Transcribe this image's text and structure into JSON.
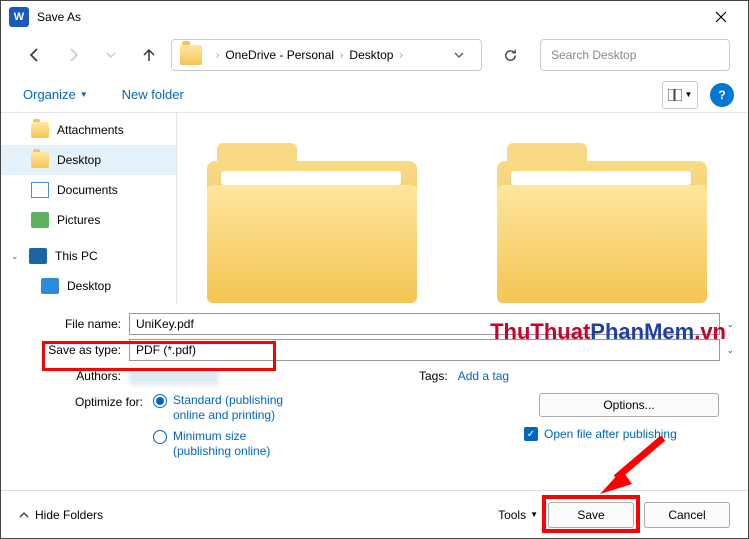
{
  "titlebar": {
    "app_glyph": "W",
    "title": "Save As"
  },
  "nav": {
    "crumbs": [
      "OneDrive - Personal",
      "Desktop"
    ],
    "search_placeholder": "Search Desktop"
  },
  "toolbar": {
    "organize": "Organize",
    "new_folder": "New folder"
  },
  "sidebar": {
    "items": [
      {
        "label": "Attachments",
        "icon": "folder"
      },
      {
        "label": "Desktop",
        "icon": "folder",
        "selected": true
      },
      {
        "label": "Documents",
        "icon": "doc"
      },
      {
        "label": "Pictures",
        "icon": "pic"
      }
    ],
    "group": {
      "label": "This PC",
      "sub": "Desktop"
    }
  },
  "fields": {
    "file_name_label": "File name:",
    "file_name_value": "UniKey.pdf",
    "save_type_label": "Save as type:",
    "save_type_value": "PDF (*.pdf)",
    "authors_label": "Authors:",
    "tags_label": "Tags:",
    "add_tag": "Add a tag"
  },
  "optimize": {
    "label": "Optimize for:",
    "opt1_line1": "Standard (publishing",
    "opt1_line2": "online and printing)",
    "opt2_line1": "Minimum size",
    "opt2_line2": "(publishing online)"
  },
  "right_opts": {
    "options_btn": "Options...",
    "open_after": "Open file after publishing"
  },
  "footer": {
    "hide": "Hide Folders",
    "tools": "Tools",
    "save": "Save",
    "cancel": "Cancel"
  },
  "watermark": {
    "t1": "ThuThuat",
    "t2": "PhanMem",
    "t3": ".vn"
  }
}
